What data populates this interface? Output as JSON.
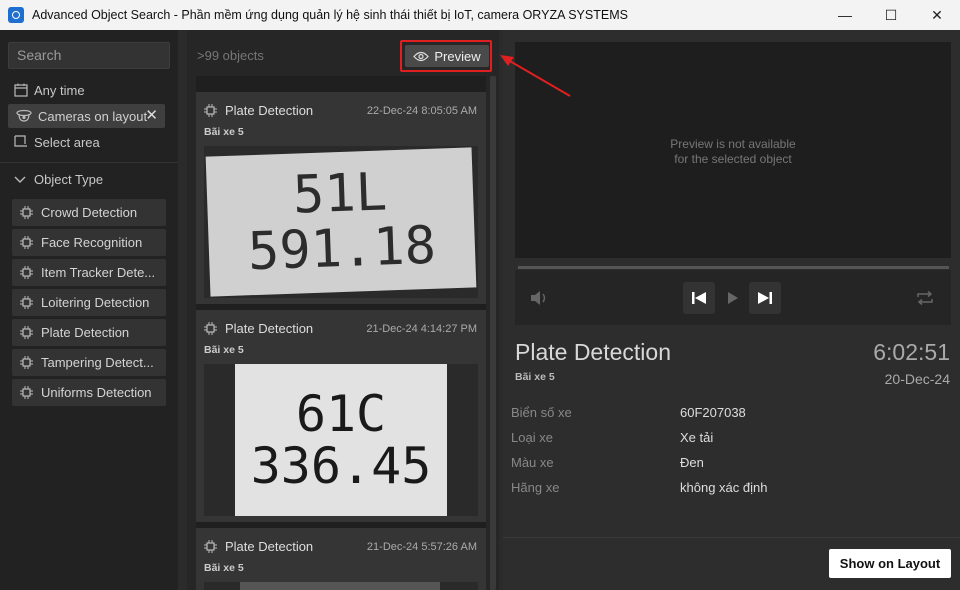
{
  "window": {
    "title": "Advanced Object Search - Phần mềm ứng dụng quản lý hệ sinh thái thiết bị IoT, camera ORYZA SYSTEMS",
    "minimize_glyph": "—",
    "maximize_glyph": "☐",
    "close_glyph": "✕"
  },
  "sidebar": {
    "search_placeholder": "Search",
    "any_time": "Any time",
    "cameras_chip": "Cameras on layout",
    "chip_remove": "✕",
    "select_area": "Select area",
    "object_type_header": "Object Type",
    "object_types": [
      "Crowd Detection",
      "Face Recognition",
      "Item Tracker Dete...",
      "Loitering Detection",
      "Plate Detection",
      "Tampering Detect...",
      "Uniforms Detection"
    ]
  },
  "results": {
    "count": ">99 objects",
    "preview_button": "Preview",
    "cards": [
      {
        "title": "Plate Detection",
        "time": "22-Dec-24 8:05:05 AM",
        "camera": "Bãi xe 5",
        "plate_line1": "51L",
        "plate_line2": "591.18"
      },
      {
        "title": "Plate Detection",
        "time": "21-Dec-24 4:14:27 PM",
        "camera": "Bãi xe 5",
        "plate_line1": "61C",
        "plate_line2": "336.45"
      },
      {
        "title": "Plate Detection",
        "time": "21-Dec-24 5:57:26 AM",
        "camera": "Bãi xe 5"
      }
    ]
  },
  "preview": {
    "unavailable_line1": "Preview is not available",
    "unavailable_line2": "for the selected object",
    "object_title": "Plate Detection",
    "camera": "Bãi xe 5",
    "time": "6:02:51",
    "date": "20-Dec-24",
    "attributes": [
      {
        "label": "Biển số xe",
        "value": "60F207038"
      },
      {
        "label": "Loại xe",
        "value": "Xe tải"
      },
      {
        "label": "Màu xe",
        "value": "Đen"
      },
      {
        "label": "Hãng xe",
        "value": "không xác định"
      }
    ],
    "show_on_layout": "Show on Layout"
  },
  "colors": {
    "highlight": "#e02020",
    "background": "#2b2b2b",
    "card": "#353535"
  }
}
